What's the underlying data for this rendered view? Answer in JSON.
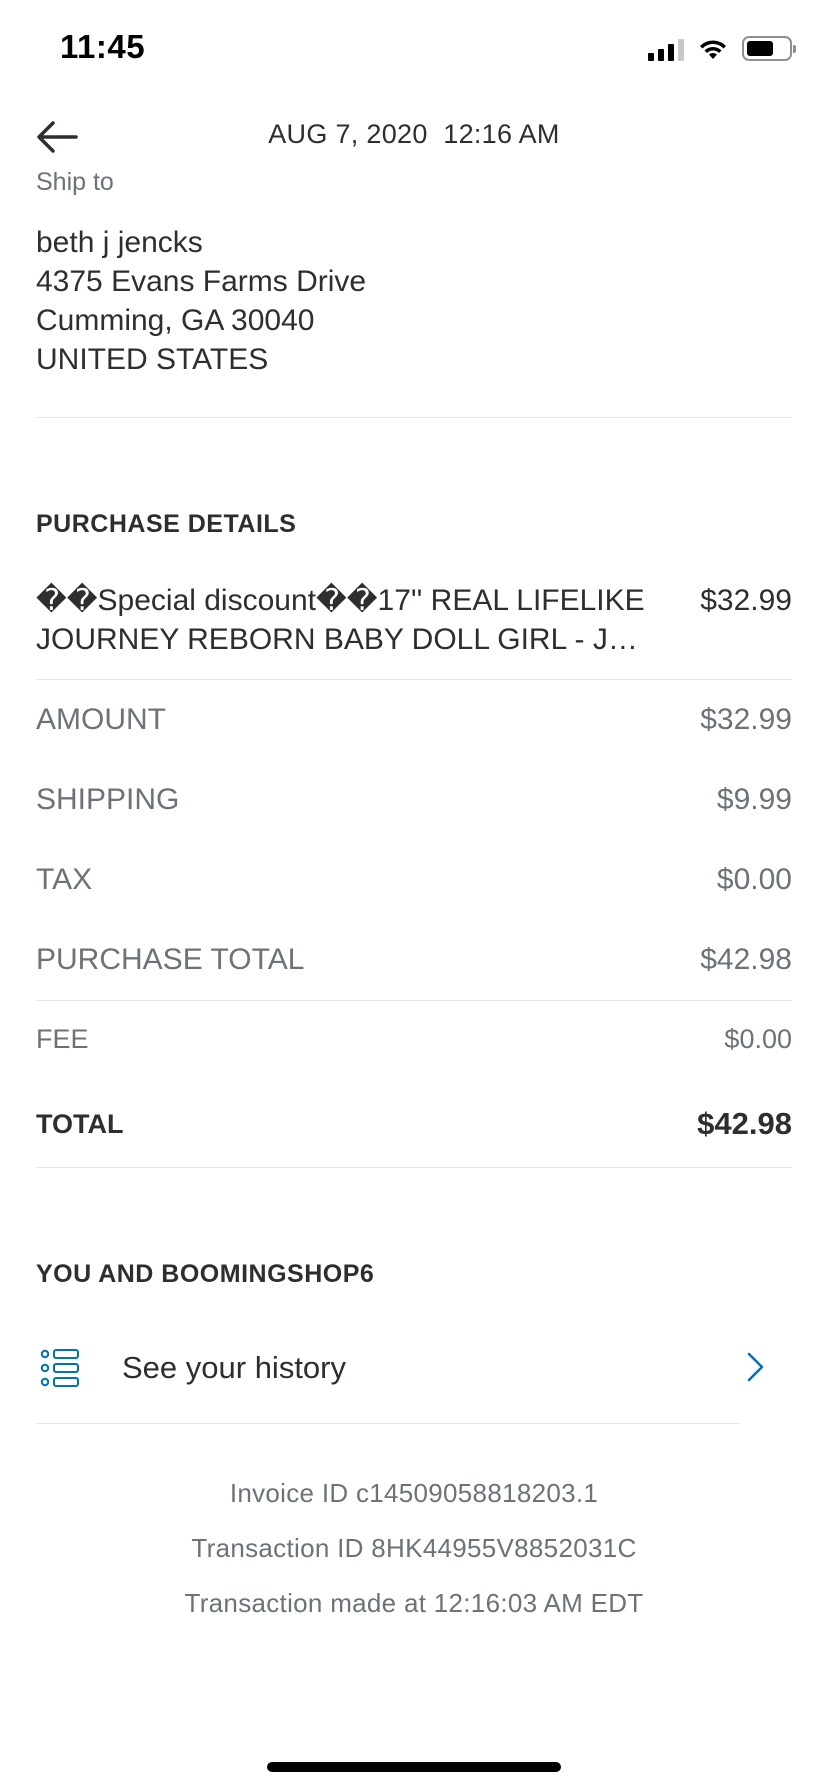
{
  "status_bar": {
    "time": "11:45",
    "icons": [
      "cellular-signal-icon",
      "wifi-icon",
      "battery-icon"
    ],
    "battery_level": 0.65
  },
  "header": {
    "date": "AUG 7, 2020  12:16 AM",
    "back_icon": "arrow-left-icon"
  },
  "ship_to": {
    "label": "Ship to",
    "name": "beth j jencks",
    "street": "4375 Evans Farms Drive",
    "city_state_zip": "Cumming, GA 30040",
    "country": "UNITED STATES"
  },
  "purchase_details": {
    "title": "PURCHASE DETAILS",
    "item": {
      "line1": "��Special discount��17'' REAL LIFELIKE",
      "line2": "JOURNEY REBORN BABY DOLL GIRL - JOU...",
      "price": "$32.99"
    },
    "amount": {
      "label": "AMOUNT",
      "value": "$32.99"
    },
    "shipping": {
      "label": "SHIPPING",
      "value": "$9.99"
    },
    "tax": {
      "label": "TAX",
      "value": "$0.00"
    },
    "purchase_total": {
      "label": "PURCHASE TOTAL",
      "value": "$42.98"
    },
    "fee": {
      "label": "FEE",
      "value": "$0.00"
    },
    "total": {
      "label": "TOTAL",
      "value": "$42.98"
    }
  },
  "relationship": {
    "title": "YOU AND BOOMINGSHOP6",
    "history_label": "See your history",
    "history_icon": "list-icon",
    "chevron_icon": "chevron-right-icon"
  },
  "meta": {
    "invoice": "Invoice ID c14509058818203.1",
    "transaction": "Transaction ID 8HK44955V8852031C",
    "made_at": "Transaction made at 12:16:03 AM EDT"
  },
  "colors": {
    "text_primary": "#2c2e2f",
    "text_secondary": "#6c7378",
    "divider": "#e6e7e8",
    "accent": "#0070ba"
  }
}
